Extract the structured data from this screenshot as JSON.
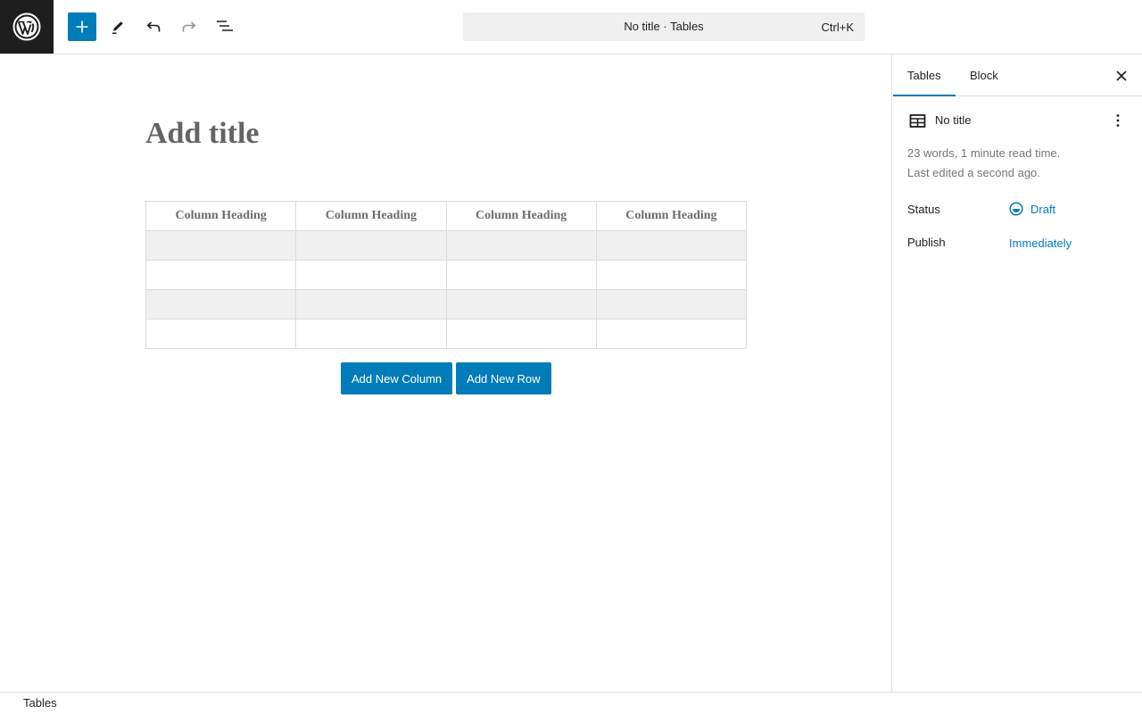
{
  "toolbar": {
    "logo_icon": "wordpress-icon",
    "add_block_icon": "plus-icon",
    "tools_icon": "pencil-icon",
    "undo_icon": "undo-icon",
    "redo_icon": "redo-icon",
    "document_overview_icon": "list-view-icon",
    "accent": "#007cba"
  },
  "command_bar": {
    "title": "No title · Tables",
    "shortcut": "Ctrl+K"
  },
  "editor": {
    "title_placeholder": "Add title",
    "table": {
      "headers": [
        "Column Heading",
        "Column Heading",
        "Column Heading",
        "Column Heading"
      ],
      "rows": [
        [
          "",
          "",
          "",
          ""
        ],
        [
          "",
          "",
          "",
          ""
        ],
        [
          "",
          "",
          "",
          ""
        ],
        [
          "",
          "",
          "",
          ""
        ]
      ]
    },
    "buttons": {
      "add_column": "Add New Column",
      "add_row": "Add New Row"
    }
  },
  "sidebar": {
    "tabs": [
      {
        "label": "Tables",
        "active": true
      },
      {
        "label": "Block",
        "active": false
      }
    ],
    "close_icon": "close-icon",
    "document": {
      "icon": "table-icon",
      "title": "No title",
      "more_icon": "more-vertical-icon",
      "meta_line1": "23 words, 1 minute read time.",
      "meta_line2": "Last edited a second ago."
    },
    "status": {
      "label": "Status",
      "value": "Draft",
      "icon": "draft-status-icon"
    },
    "publish": {
      "label": "Publish",
      "value": "Immediately"
    }
  },
  "footer": {
    "breadcrumb": "Tables"
  }
}
